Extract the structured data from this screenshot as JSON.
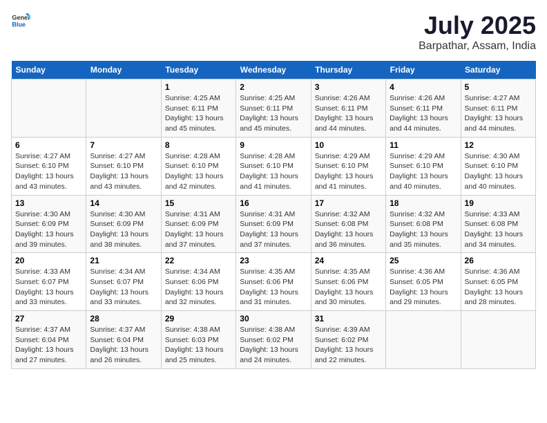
{
  "header": {
    "logo_general": "General",
    "logo_blue": "Blue",
    "month": "July 2025",
    "location": "Barpathar, Assam, India"
  },
  "calendar": {
    "days_of_week": [
      "Sunday",
      "Monday",
      "Tuesday",
      "Wednesday",
      "Thursday",
      "Friday",
      "Saturday"
    ],
    "weeks": [
      [
        {
          "day": "",
          "info": ""
        },
        {
          "day": "",
          "info": ""
        },
        {
          "day": "1",
          "info": "Sunrise: 4:25 AM\nSunset: 6:11 PM\nDaylight: 13 hours and 45 minutes."
        },
        {
          "day": "2",
          "info": "Sunrise: 4:25 AM\nSunset: 6:11 PM\nDaylight: 13 hours and 45 minutes."
        },
        {
          "day": "3",
          "info": "Sunrise: 4:26 AM\nSunset: 6:11 PM\nDaylight: 13 hours and 44 minutes."
        },
        {
          "day": "4",
          "info": "Sunrise: 4:26 AM\nSunset: 6:11 PM\nDaylight: 13 hours and 44 minutes."
        },
        {
          "day": "5",
          "info": "Sunrise: 4:27 AM\nSunset: 6:11 PM\nDaylight: 13 hours and 44 minutes."
        }
      ],
      [
        {
          "day": "6",
          "info": "Sunrise: 4:27 AM\nSunset: 6:10 PM\nDaylight: 13 hours and 43 minutes."
        },
        {
          "day": "7",
          "info": "Sunrise: 4:27 AM\nSunset: 6:10 PM\nDaylight: 13 hours and 43 minutes."
        },
        {
          "day": "8",
          "info": "Sunrise: 4:28 AM\nSunset: 6:10 PM\nDaylight: 13 hours and 42 minutes."
        },
        {
          "day": "9",
          "info": "Sunrise: 4:28 AM\nSunset: 6:10 PM\nDaylight: 13 hours and 41 minutes."
        },
        {
          "day": "10",
          "info": "Sunrise: 4:29 AM\nSunset: 6:10 PM\nDaylight: 13 hours and 41 minutes."
        },
        {
          "day": "11",
          "info": "Sunrise: 4:29 AM\nSunset: 6:10 PM\nDaylight: 13 hours and 40 minutes."
        },
        {
          "day": "12",
          "info": "Sunrise: 4:30 AM\nSunset: 6:10 PM\nDaylight: 13 hours and 40 minutes."
        }
      ],
      [
        {
          "day": "13",
          "info": "Sunrise: 4:30 AM\nSunset: 6:09 PM\nDaylight: 13 hours and 39 minutes."
        },
        {
          "day": "14",
          "info": "Sunrise: 4:30 AM\nSunset: 6:09 PM\nDaylight: 13 hours and 38 minutes."
        },
        {
          "day": "15",
          "info": "Sunrise: 4:31 AM\nSunset: 6:09 PM\nDaylight: 13 hours and 37 minutes."
        },
        {
          "day": "16",
          "info": "Sunrise: 4:31 AM\nSunset: 6:09 PM\nDaylight: 13 hours and 37 minutes."
        },
        {
          "day": "17",
          "info": "Sunrise: 4:32 AM\nSunset: 6:08 PM\nDaylight: 13 hours and 36 minutes."
        },
        {
          "day": "18",
          "info": "Sunrise: 4:32 AM\nSunset: 6:08 PM\nDaylight: 13 hours and 35 minutes."
        },
        {
          "day": "19",
          "info": "Sunrise: 4:33 AM\nSunset: 6:08 PM\nDaylight: 13 hours and 34 minutes."
        }
      ],
      [
        {
          "day": "20",
          "info": "Sunrise: 4:33 AM\nSunset: 6:07 PM\nDaylight: 13 hours and 33 minutes."
        },
        {
          "day": "21",
          "info": "Sunrise: 4:34 AM\nSunset: 6:07 PM\nDaylight: 13 hours and 33 minutes."
        },
        {
          "day": "22",
          "info": "Sunrise: 4:34 AM\nSunset: 6:06 PM\nDaylight: 13 hours and 32 minutes."
        },
        {
          "day": "23",
          "info": "Sunrise: 4:35 AM\nSunset: 6:06 PM\nDaylight: 13 hours and 31 minutes."
        },
        {
          "day": "24",
          "info": "Sunrise: 4:35 AM\nSunset: 6:06 PM\nDaylight: 13 hours and 30 minutes."
        },
        {
          "day": "25",
          "info": "Sunrise: 4:36 AM\nSunset: 6:05 PM\nDaylight: 13 hours and 29 minutes."
        },
        {
          "day": "26",
          "info": "Sunrise: 4:36 AM\nSunset: 6:05 PM\nDaylight: 13 hours and 28 minutes."
        }
      ],
      [
        {
          "day": "27",
          "info": "Sunrise: 4:37 AM\nSunset: 6:04 PM\nDaylight: 13 hours and 27 minutes."
        },
        {
          "day": "28",
          "info": "Sunrise: 4:37 AM\nSunset: 6:04 PM\nDaylight: 13 hours and 26 minutes."
        },
        {
          "day": "29",
          "info": "Sunrise: 4:38 AM\nSunset: 6:03 PM\nDaylight: 13 hours and 25 minutes."
        },
        {
          "day": "30",
          "info": "Sunrise: 4:38 AM\nSunset: 6:02 PM\nDaylight: 13 hours and 24 minutes."
        },
        {
          "day": "31",
          "info": "Sunrise: 4:39 AM\nSunset: 6:02 PM\nDaylight: 13 hours and 22 minutes."
        },
        {
          "day": "",
          "info": ""
        },
        {
          "day": "",
          "info": ""
        }
      ]
    ]
  }
}
